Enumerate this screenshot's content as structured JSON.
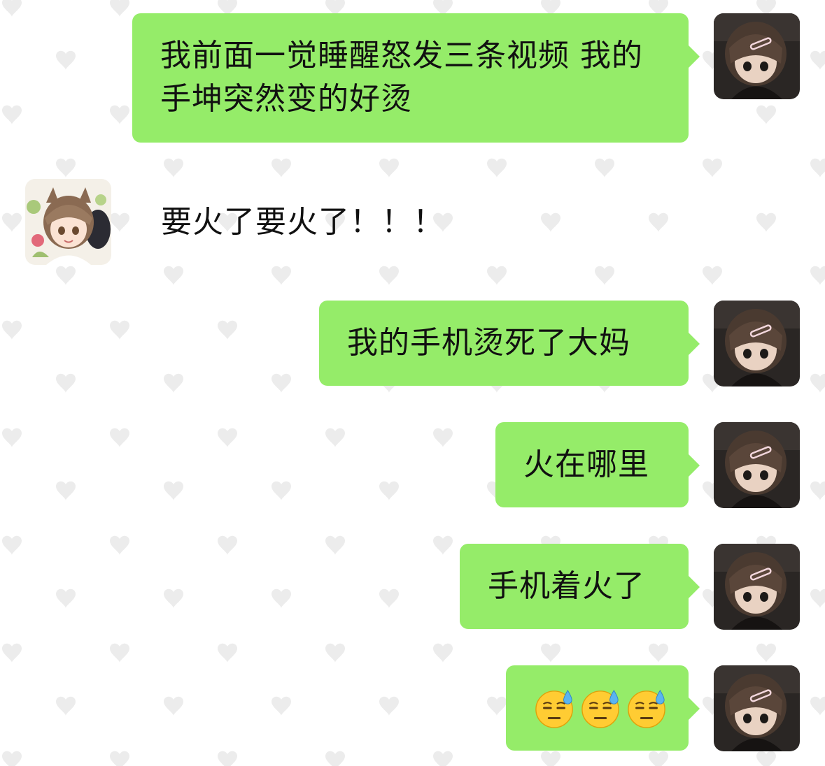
{
  "colors": {
    "outgoing_bubble": "#95ec69",
    "background": "#ffffff",
    "heart_pattern": "#ececec"
  },
  "messages": [
    {
      "side": "outgoing",
      "text": "我前面一觉睡醒怒发三条视频 我的手坤突然变的好烫"
    },
    {
      "side": "incoming",
      "text": "要火了要火了！！！"
    },
    {
      "side": "outgoing",
      "text": "我的手机烫死了大妈"
    },
    {
      "side": "outgoing",
      "text": "火在哪里"
    },
    {
      "side": "outgoing",
      "text": "手机着火了"
    },
    {
      "side": "outgoing",
      "emoji": [
        "downcast-face-with-sweat",
        "downcast-face-with-sweat",
        "downcast-face-with-sweat"
      ]
    }
  ],
  "avatars": {
    "self": "doll-avatar",
    "contact": "anime-boy-avatar"
  }
}
